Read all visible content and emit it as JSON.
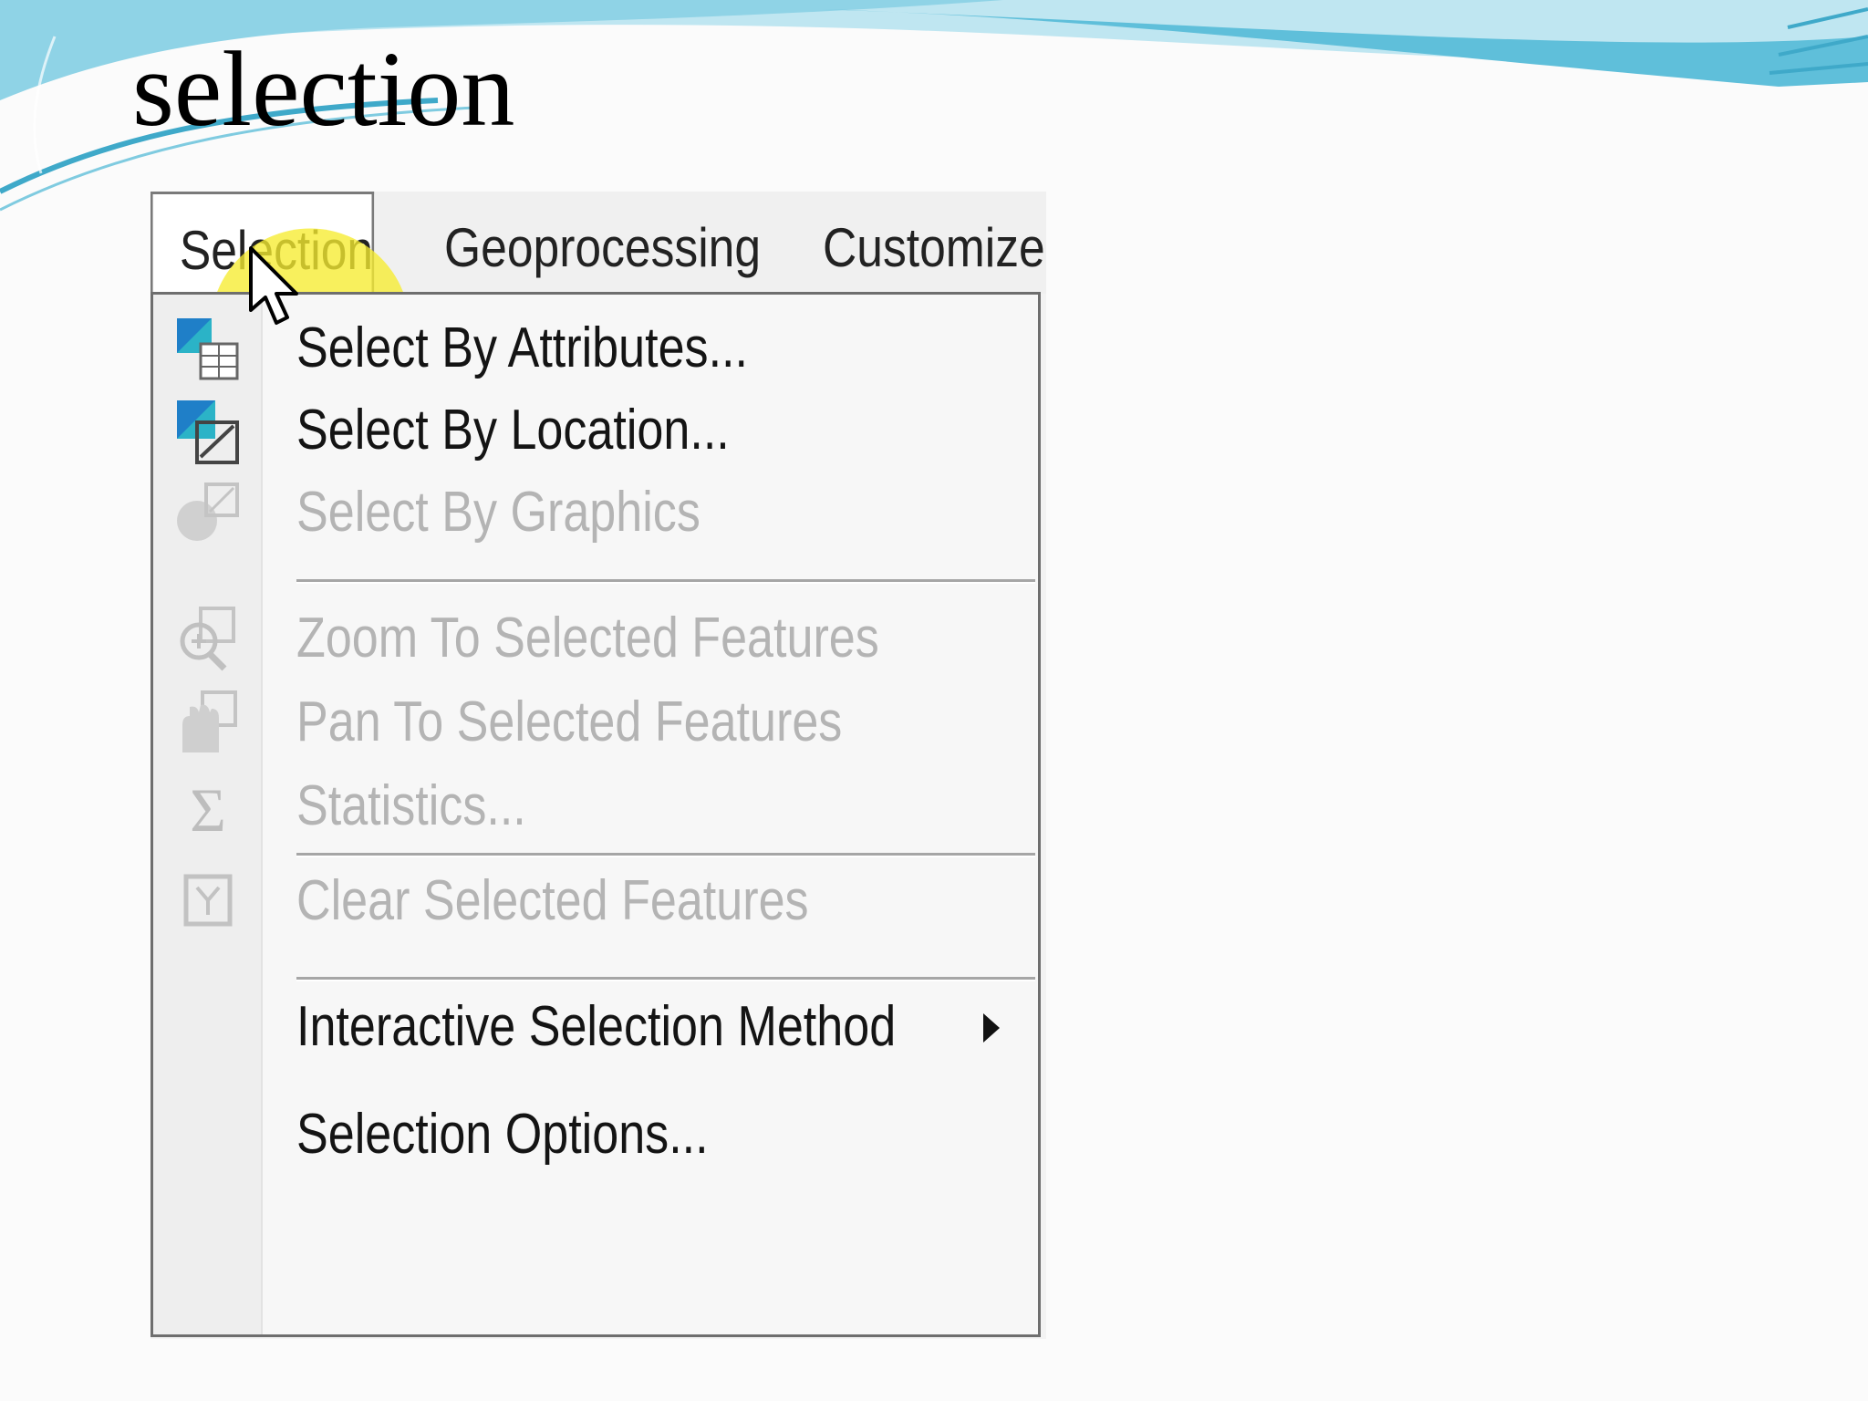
{
  "slide": {
    "title": "selection"
  },
  "menubar": {
    "items": [
      {
        "label": "Selection",
        "active": true
      },
      {
        "label": "Geoprocessing",
        "active": false
      },
      {
        "label": "Customize",
        "active": false
      }
    ]
  },
  "menu": {
    "items": [
      {
        "label": "Select By Attributes...",
        "enabled": true,
        "icon": "select-by-attributes-icon"
      },
      {
        "label": "Select By Location...",
        "enabled": true,
        "icon": "select-by-location-icon"
      },
      {
        "label": "Select By Graphics",
        "enabled": false,
        "icon": "select-by-graphics-icon"
      },
      {
        "label": "Zoom To Selected Features",
        "enabled": false,
        "icon": "zoom-to-selected-icon"
      },
      {
        "label": "Pan To Selected Features",
        "enabled": false,
        "icon": "pan-to-selected-icon"
      },
      {
        "label": "Statistics...",
        "enabled": false,
        "icon": "sigma-icon"
      },
      {
        "label": "Clear Selected Features",
        "enabled": false,
        "icon": "clear-selection-icon"
      },
      {
        "label": "Interactive Selection Method",
        "enabled": true,
        "submenu": true
      },
      {
        "label": "Selection Options...",
        "enabled": true
      }
    ]
  },
  "colors": {
    "slide_wave": "#8fd3e6",
    "slide_wave_dark": "#3fa9c9",
    "highlight": "#f6ec30",
    "icon_blue": "#1f7fc8",
    "icon_teal": "#2bb3c7",
    "disabled_text": "#b4b4b4"
  }
}
